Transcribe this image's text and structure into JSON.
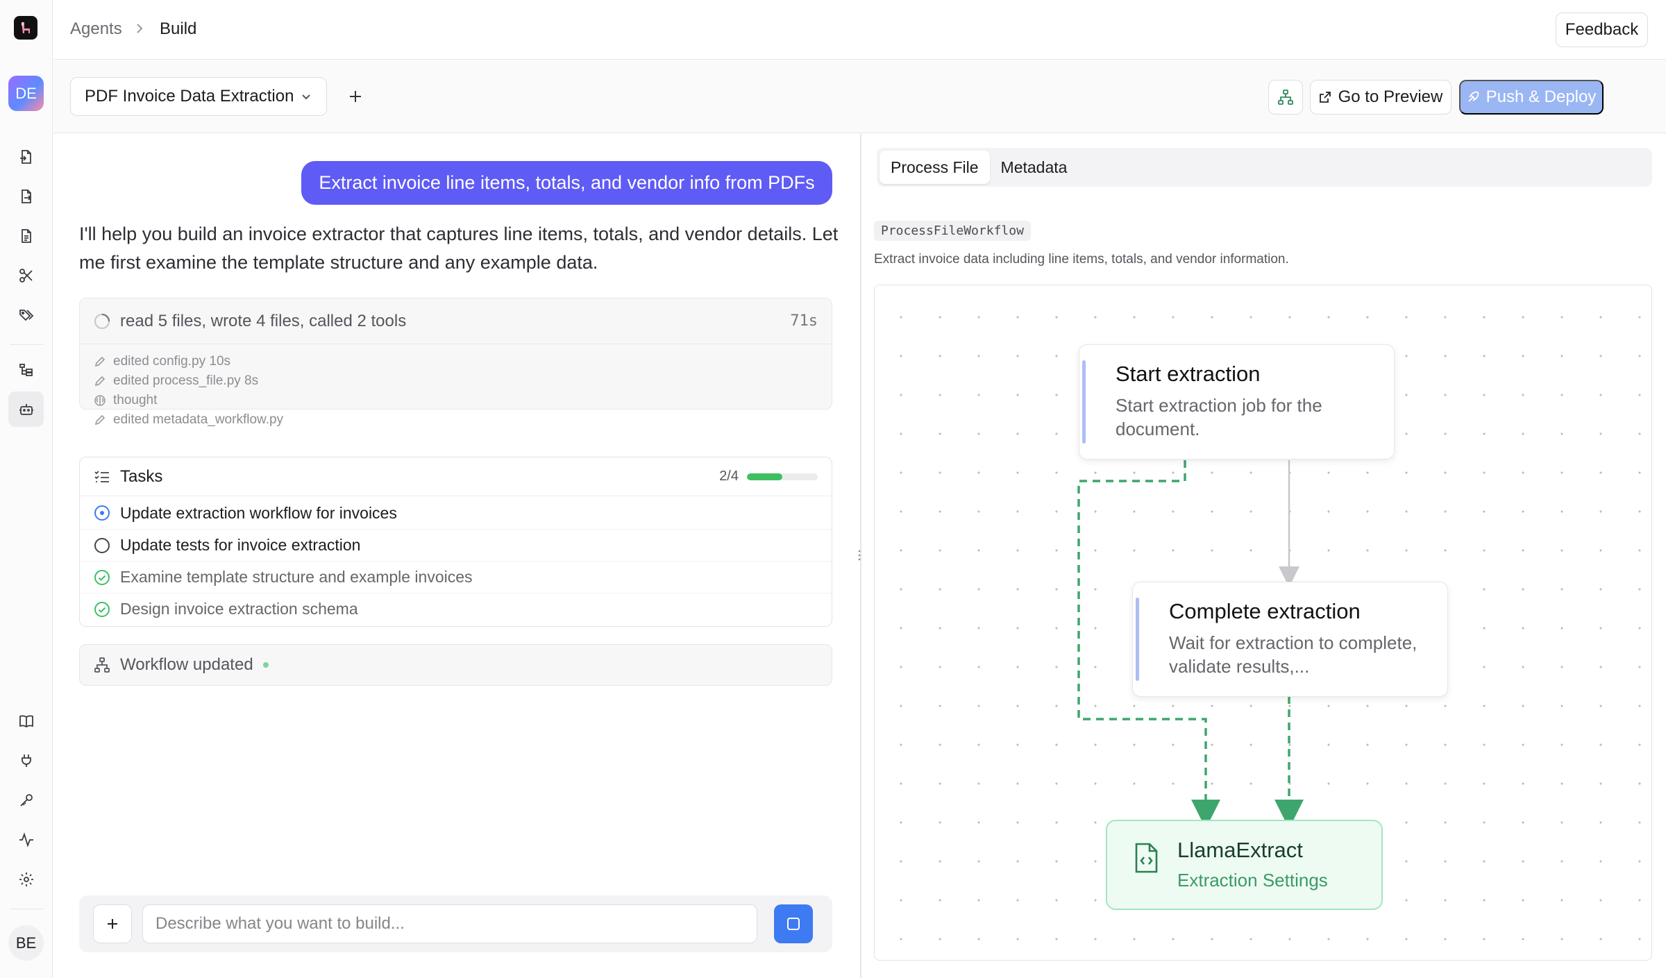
{
  "rail": {
    "avatar_initials": "DE",
    "user_initials": "BE"
  },
  "breadcrumb": {
    "parent": "Agents",
    "current": "Build"
  },
  "topbar": {
    "feedback_label": "Feedback"
  },
  "toolbar": {
    "workflow_name": "PDF Invoice Data Extraction",
    "preview_label": "Go to Preview",
    "deploy_label": "Push & Deploy"
  },
  "chat": {
    "user_message": "Extract invoice line items, totals, and vendor info from PDFs",
    "assistant_message": "I'll help you build an invoice extractor that captures line items, totals, and vendor details. Let me first examine the template structure and any example data.",
    "activity": {
      "summary": "read 5 files, wrote 4 files, called 2 tools",
      "duration": "71s",
      "items": [
        "edited config.py 10s",
        "edited process_file.py 8s",
        "thought",
        "edited metadata_workflow.py"
      ]
    },
    "tasks": {
      "title": "Tasks",
      "count": "2/4",
      "progress": 0.5,
      "items": [
        {
          "label": "Update extraction workflow for invoices",
          "status": "in-progress"
        },
        {
          "label": "Update tests for invoice extraction",
          "status": "pending"
        },
        {
          "label": "Examine template structure and example invoices",
          "status": "done"
        },
        {
          "label": "Design invoice extraction schema",
          "status": "done"
        }
      ]
    },
    "workflow_updated": "Workflow updated",
    "composer_placeholder": "Describe what you want to build..."
  },
  "right": {
    "tabs": [
      "Process File",
      "Metadata"
    ],
    "workflow_class": "ProcessFileWorkflow",
    "workflow_desc": "Extract invoice data including line items, totals, and vendor information.",
    "nodes": {
      "start": {
        "title": "Start extraction",
        "desc": "Start extraction job for the document."
      },
      "complete": {
        "title": "Complete extraction",
        "desc": "Wait for extraction to complete, validate results,..."
      },
      "llama": {
        "title": "LlamaExtract",
        "sub": "Extraction Settings"
      }
    }
  },
  "colors": {
    "accent": "#5f5bf5",
    "send": "#3e7af2",
    "deploy_disabled": "#9ab6f3",
    "success": "#3fbf62",
    "edge_dashed": "#3ea66d"
  }
}
